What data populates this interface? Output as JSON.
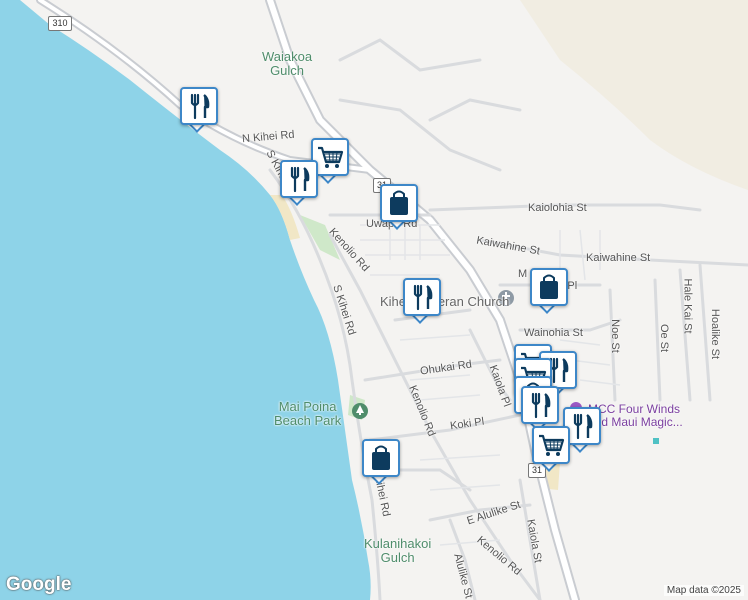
{
  "map": {
    "colors": {
      "water": "#8ed3e8",
      "land": "#f4f3f1",
      "road": "#ffffff",
      "highway": "#c9ccd1",
      "park": "#cfe8c9",
      "beach": "#f1e7c6",
      "marker_border": "#3d87c8",
      "marker_icon": "#0d3b5e",
      "worship_icon": "#8e9aa5",
      "poi_green": "#4f8d6b",
      "poi_purple": "#7b3fa0"
    }
  },
  "labels": {
    "route_310": "310",
    "route_31a": "31",
    "route_31b": "31",
    "waiakoa": "Waiakoa\nGulch",
    "n_kihei_rd": "N Kihei Rd",
    "s_kihei_rd_upper": "S Kihei Rd",
    "s_kihei_rd_mid": "S Kihei Rd",
    "s_kihei_rd_lower": "S Kihei Rd",
    "uwapo_rd": "Uwapo Rd",
    "kenolio_rd_upper": "Kenolio Rd",
    "kenolio_rd_mid": "Kenolio Rd",
    "kenolio_rd_lower": "Kenolio Rd",
    "kaiolohia_st": "Kaiolohia St",
    "kaiwahine_st_a": "Kaiwahine St",
    "kaiwahine_st_b": "Kaiwahine St",
    "m_partial": "M",
    "nehu_pl": "Nehu Pl",
    "church": "Kihei Lutheran Church",
    "wainohia_st": "Wainohia St",
    "noe_st": "Noe St",
    "oe_st": "Oe St",
    "hale_kai_st": "Hale Kai St",
    "hoalike_st": "Hoalike St",
    "ohukai_rd": "Ohukai Rd",
    "kaiola_pl": "Kaiola Pl",
    "koki_pl": "Koki Pl",
    "mai_poina": "Mai Poina\nBeach Park",
    "mcc": "MCC Four Winds\nand Maui Magic...",
    "e_alulike_st": "E Alulike St",
    "alulike_st": "Alulike St",
    "kaiola_st": "Kaiola St",
    "kulanihakoi": "Kulanihakoi\nGulch"
  },
  "markers": [
    {
      "type": "restaurant",
      "icon": "fork-knife-icon"
    },
    {
      "type": "grocery",
      "icon": "shopping-cart-icon"
    },
    {
      "type": "restaurant",
      "icon": "fork-knife-icon"
    },
    {
      "type": "shopping",
      "icon": "shopping-bag-icon"
    },
    {
      "type": "restaurant",
      "icon": "fork-knife-icon"
    },
    {
      "type": "shopping",
      "icon": "shopping-bag-icon"
    },
    {
      "type": "grocery",
      "icon": "shopping-cart-icon"
    },
    {
      "type": "restaurant",
      "icon": "fork-knife-icon"
    },
    {
      "type": "grocery",
      "icon": "shopping-cart-icon"
    },
    {
      "type": "shopping",
      "icon": "shopping-bag-icon"
    },
    {
      "type": "restaurant",
      "icon": "fork-knife-icon"
    },
    {
      "type": "restaurant",
      "icon": "fork-knife-icon"
    },
    {
      "type": "grocery",
      "icon": "shopping-cart-icon"
    },
    {
      "type": "shopping",
      "icon": "shopping-bag-icon"
    }
  ],
  "footer": {
    "logo": "Google",
    "attribution": "Map data ©2025"
  }
}
